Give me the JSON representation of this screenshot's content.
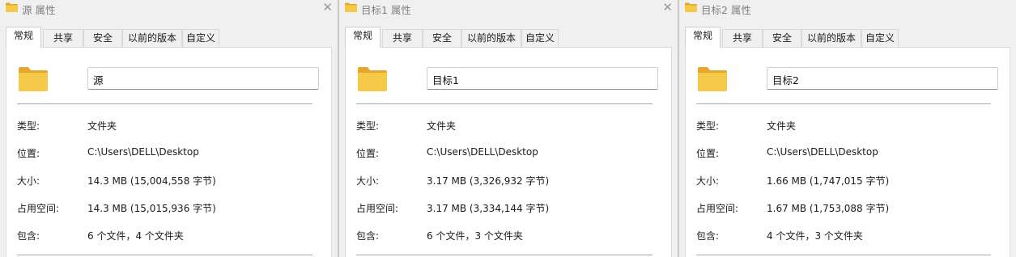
{
  "colors": {
    "folder": "#f5c542",
    "folder_dark": "#e5a82b"
  },
  "tabs": [
    "常规",
    "共享",
    "安全",
    "以前的版本",
    "自定义"
  ],
  "labels": {
    "type": "类型:",
    "location": "位置:",
    "size": "大小:",
    "size_on_disk": "占用空间:",
    "contains": "包含:"
  },
  "windows": [
    {
      "title": "源 属性",
      "name": "源",
      "type": "文件夹",
      "location": "C:\\Users\\DELL\\Desktop",
      "size": "14.3 MB (15,004,558 字节)",
      "size_on_disk": "14.3 MB (15,015,936 字节)",
      "contains": "6 个文件，4 个文件夹"
    },
    {
      "title": "目标1 属性",
      "name": "目标1",
      "type": "文件夹",
      "location": "C:\\Users\\DELL\\Desktop",
      "size": "3.17 MB (3,326,932 字节)",
      "size_on_disk": "3.17 MB (3,334,144 字节)",
      "contains": "6 个文件，3 个文件夹"
    },
    {
      "title": "目标2 属性",
      "name": "目标2",
      "type": "文件夹",
      "location": "C:\\Users\\DELL\\Desktop",
      "size": "1.66 MB (1,747,015 字节)",
      "size_on_disk": "1.67 MB (1,753,088 字节)",
      "contains": "4 个文件，3 个文件夹"
    }
  ]
}
